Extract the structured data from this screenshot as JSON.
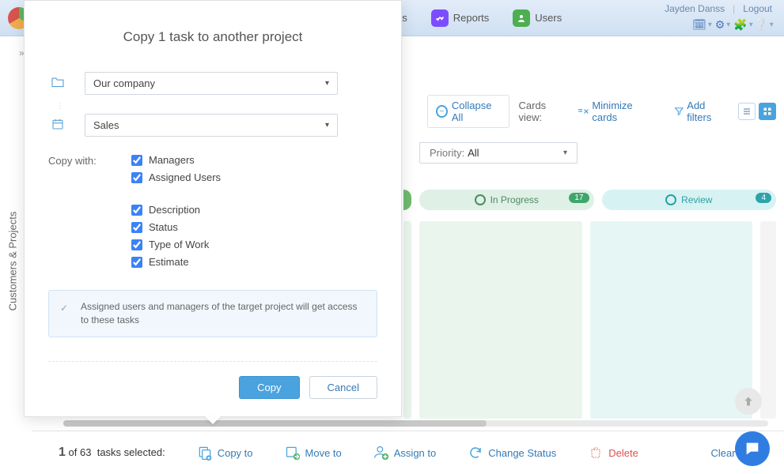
{
  "header": {
    "nav": {
      "tasks": "asks",
      "reports": "Reports",
      "users": "Users"
    },
    "user_name": "Jayden Danss",
    "logout": "Logout"
  },
  "side_label": "Customers & Projects",
  "toolbar": {
    "collapse_all": "Collapse All",
    "cards_view_label": "Cards view:",
    "minimize_cards": "Minimize cards",
    "add_filters": "Add filters"
  },
  "priority": {
    "label": "Priority:",
    "value": "All"
  },
  "kanban": {
    "columns": [
      {
        "name": "In Progress",
        "count": "17"
      },
      {
        "name": "Review",
        "count": "4"
      }
    ]
  },
  "bottombar": {
    "selected_num": "1",
    "of": "of",
    "total": "63",
    "tasks_selected": "tasks selected:",
    "copy_to": "Copy to",
    "move_to": "Move to",
    "assign_to": "Assign to",
    "change_status": "Change Status",
    "delete": "Delete",
    "clear_selection": "Clear sele"
  },
  "modal": {
    "title": "Copy 1 task to another project",
    "project_customer": "Our company",
    "project_target": "Sales",
    "copy_with_label": "Copy with:",
    "options": {
      "managers": "Managers",
      "assigned_users": "Assigned Users",
      "description": "Description",
      "status": "Status",
      "type_of_work": "Type of Work",
      "estimate": "Estimate"
    },
    "note": "Assigned users and managers of the target project will get access to these tasks",
    "copy_btn": "Copy",
    "cancel_btn": "Cancel"
  }
}
